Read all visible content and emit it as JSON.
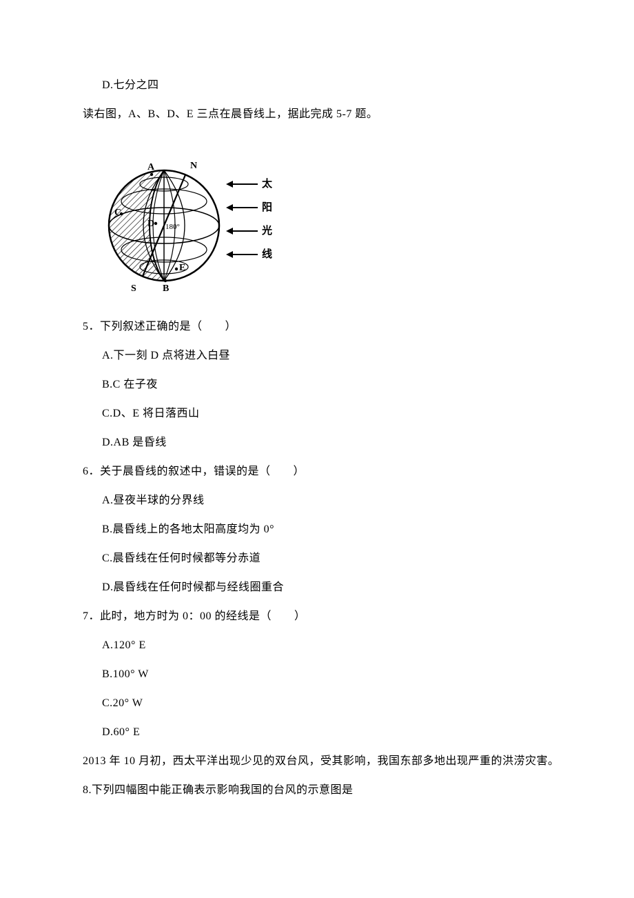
{
  "prev_q4": {
    "opt_d": "D.七分之四"
  },
  "stem_5_7": "读右图，A、B、D、E 三点在晨昏线上，据此完成 5-7 题。",
  "figure": {
    "labels": {
      "A": "A",
      "B": "B",
      "C": "C",
      "D": "D",
      "E": "E",
      "N": "N",
      "S": "S",
      "lon180": "180°"
    },
    "arrows": {
      "sun1": "太",
      "sun2": "阳",
      "light1": "光",
      "light2": "线"
    }
  },
  "q5": {
    "stem": "5．下列叙述正确的是（　　）",
    "a": "A.下一刻 D 点将进入白昼",
    "b": "B.C 在子夜",
    "c": "C.D、E 将日落西山",
    "d": "D.AB 是昏线"
  },
  "q6": {
    "stem": "6．关于晨昏线的叙述中，错误的是（　　）",
    "a": "A.昼夜半球的分界线",
    "b": "B.晨昏线上的各地太阳高度均为 0°",
    "c": "C.晨昏线在任何时候都等分赤道",
    "d": "D.晨昏线在任何时候都与经线圈重合"
  },
  "q7": {
    "stem": "7．此时，地方时为 0：00 的经线是（　　）",
    "a": "A.120° E",
    "b": "B.100° W",
    "c": "C.20° W",
    "d": "D.60° E"
  },
  "stem_8": "2013 年 10 月初，西太平洋出现少见的双台风，受其影响，我国东部多地出现严重的洪涝灾害。",
  "q8": {
    "stem": "8.下列四幅图中能正确表示影响我国的台风的示意图是"
  }
}
